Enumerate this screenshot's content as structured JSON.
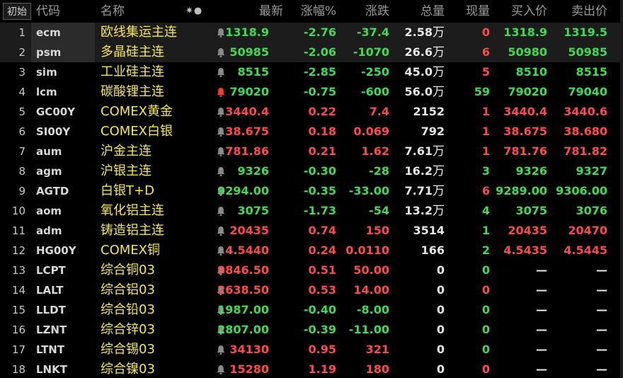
{
  "header": {
    "init_button": "初始",
    "col_code": "代码",
    "col_name": "名称",
    "col_last": "最新",
    "col_pct": "涨幅%",
    "col_chg": "涨跌",
    "col_vol": "总量",
    "col_cur": "现量",
    "col_bid": "买入价",
    "col_ask": "卖出价",
    "settings_glyph": "✷●"
  },
  "colors": {
    "up": "#ff4a4a",
    "down": "#3ddc52",
    "name": "#f5e74a",
    "bell_normal": "#8a8a8a",
    "bell_active": "#ff3b2e"
  },
  "rows": [
    {
      "idx": "1",
      "code": "ecm",
      "name": "欧线集运主连",
      "last": "1318.9",
      "pct": "-2.76",
      "chg": "-37.4",
      "vol": "2.58",
      "vol_unit": "万",
      "cur": "0",
      "bid": "1318.9",
      "ask": "1319.5",
      "dir": "down",
      "cur_dir": "up",
      "bell": "normal",
      "selected": true
    },
    {
      "idx": "2",
      "code": "psm",
      "name": "多晶硅主连",
      "last": "50985",
      "pct": "-2.06",
      "chg": "-1070",
      "vol": "26.6",
      "vol_unit": "万",
      "cur": "6",
      "bid": "50980",
      "ask": "50985",
      "dir": "down",
      "cur_dir": "up",
      "bell": "normal",
      "selected": true
    },
    {
      "idx": "3",
      "code": "sim",
      "name": "工业硅主连",
      "last": "8515",
      "pct": "-2.85",
      "chg": "-250",
      "vol": "45.0",
      "vol_unit": "万",
      "cur": "5",
      "bid": "8510",
      "ask": "8515",
      "dir": "down",
      "cur_dir": "up",
      "bell": "normal",
      "selected": false
    },
    {
      "idx": "4",
      "code": "lcm",
      "name": "碳酸锂主连",
      "last": "79020",
      "pct": "-0.75",
      "chg": "-600",
      "vol": "56.0",
      "vol_unit": "万",
      "cur": "59",
      "bid": "79020",
      "ask": "79040",
      "dir": "down",
      "cur_dir": "down",
      "bell": "active",
      "selected": false
    },
    {
      "idx": "5",
      "code": "GC00Y",
      "name": "COMEX黄金",
      "last": "3440.4",
      "pct": "0.22",
      "chg": "7.4",
      "vol": "2152",
      "vol_unit": "",
      "cur": "1",
      "bid": "3440.4",
      "ask": "3440.6",
      "dir": "up",
      "cur_dir": "up",
      "bell": "normal",
      "selected": false
    },
    {
      "idx": "6",
      "code": "SI00Y",
      "name": "COMEX白银",
      "last": "38.675",
      "pct": "0.18",
      "chg": "0.069",
      "vol": "792",
      "vol_unit": "",
      "cur": "1",
      "bid": "38.675",
      "ask": "38.680",
      "dir": "up",
      "cur_dir": "up",
      "bell": "normal",
      "selected": false
    },
    {
      "idx": "7",
      "code": "aum",
      "name": "沪金主连",
      "last": "781.86",
      "pct": "0.21",
      "chg": "1.62",
      "vol": "7.61",
      "vol_unit": "万",
      "cur": "1",
      "bid": "781.76",
      "ask": "781.82",
      "dir": "up",
      "cur_dir": "up",
      "bell": "normal",
      "selected": false
    },
    {
      "idx": "8",
      "code": "agm",
      "name": "沪银主连",
      "last": "9326",
      "pct": "-0.30",
      "chg": "-28",
      "vol": "16.2",
      "vol_unit": "万",
      "cur": "3",
      "bid": "9326",
      "ask": "9327",
      "dir": "down",
      "cur_dir": "down",
      "bell": "normal",
      "selected": false
    },
    {
      "idx": "9",
      "code": "AGTD",
      "name": "白银T+D",
      "last": "9294.00",
      "pct": "-0.35",
      "chg": "-33.00",
      "vol": "7.71",
      "vol_unit": "万",
      "cur": "6",
      "bid": "9289.00",
      "ask": "9306.00",
      "dir": "down",
      "cur_dir": "up",
      "bell": "normal",
      "selected": false
    },
    {
      "idx": "10",
      "code": "aom",
      "name": "氧化铝主连",
      "last": "3075",
      "pct": "-1.73",
      "chg": "-54",
      "vol": "13.2",
      "vol_unit": "万",
      "cur": "4",
      "bid": "3075",
      "ask": "3076",
      "dir": "down",
      "cur_dir": "down",
      "bell": "normal",
      "selected": false
    },
    {
      "idx": "11",
      "code": "adm",
      "name": "铸造铝主连",
      "last": "20435",
      "pct": "0.74",
      "chg": "150",
      "vol": "3514",
      "vol_unit": "",
      "cur": "1",
      "bid": "20435",
      "ask": "20470",
      "dir": "up",
      "cur_dir": "down",
      "bell": "normal",
      "selected": false
    },
    {
      "idx": "12",
      "code": "HG00Y",
      "name": "COMEX铜",
      "last": "4.5440",
      "pct": "0.24",
      "chg": "0.0110",
      "vol": "166",
      "vol_unit": "",
      "cur": "2",
      "bid": "4.5435",
      "ask": "4.5445",
      "dir": "up",
      "cur_dir": "down",
      "bell": "normal",
      "selected": false
    },
    {
      "idx": "13",
      "code": "LCPT",
      "name": "综合铜03",
      "last": "9846.50",
      "pct": "0.51",
      "chg": "50.00",
      "vol": "0",
      "vol_unit": "",
      "cur": "0",
      "bid": "—",
      "ask": "—",
      "dir": "up",
      "cur_dir": "down",
      "bell": "normal",
      "selected": false
    },
    {
      "idx": "14",
      "code": "LALT",
      "name": "综合铝03",
      "last": "2638.50",
      "pct": "0.53",
      "chg": "14.00",
      "vol": "0",
      "vol_unit": "",
      "cur": "0",
      "bid": "—",
      "ask": "—",
      "dir": "up",
      "cur_dir": "up",
      "bell": "normal",
      "selected": false
    },
    {
      "idx": "15",
      "code": "LLDT",
      "name": "综合铅03",
      "last": "1987.00",
      "pct": "-0.40",
      "chg": "-8.00",
      "vol": "0",
      "vol_unit": "",
      "cur": "0",
      "bid": "—",
      "ask": "—",
      "dir": "down",
      "cur_dir": "down",
      "bell": "normal",
      "selected": false
    },
    {
      "idx": "16",
      "code": "LZNT",
      "name": "综合锌03",
      "last": "2807.00",
      "pct": "-0.39",
      "chg": "-11.00",
      "vol": "0",
      "vol_unit": "",
      "cur": "0",
      "bid": "—",
      "ask": "—",
      "dir": "down",
      "cur_dir": "down",
      "bell": "normal",
      "selected": false
    },
    {
      "idx": "17",
      "code": "LTNT",
      "name": "综合锡03",
      "last": "34130",
      "pct": "0.95",
      "chg": "321",
      "vol": "0",
      "vol_unit": "",
      "cur": "0",
      "bid": "—",
      "ask": "—",
      "dir": "up",
      "cur_dir": "down",
      "bell": "normal",
      "selected": false
    },
    {
      "idx": "18",
      "code": "LNKT",
      "name": "综合镍03",
      "last": "15280",
      "pct": "1.19",
      "chg": "180",
      "vol": "0",
      "vol_unit": "",
      "cur": "0",
      "bid": "—",
      "ask": "—",
      "dir": "up",
      "cur_dir": "up",
      "bell": "normal",
      "selected": false
    }
  ]
}
